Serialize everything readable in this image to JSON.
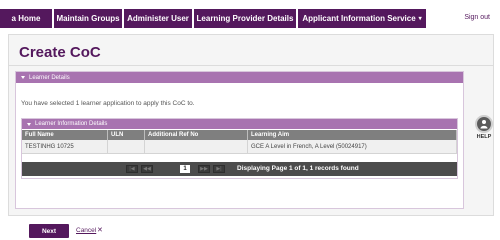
{
  "nav": {
    "items": [
      {
        "label": "a Home"
      },
      {
        "label": "Maintain Groups"
      },
      {
        "label": "Administer User"
      },
      {
        "label": "Learning Provider Details"
      },
      {
        "label": "Applicant Information Service"
      }
    ],
    "dropdown_caret": "▾",
    "signout": "Sign out"
  },
  "page": {
    "title": "Create CoC"
  },
  "learner_details": {
    "header": "Learner Details",
    "message": "You have selected 1 learner application to apply this CoC to."
  },
  "learner_info": {
    "header": "Learner Information Details",
    "columns": [
      "Full Name",
      "ULN",
      "Additional Ref No",
      "Learning Aim"
    ],
    "rows": [
      [
        "TESTINHG 10725",
        "",
        "",
        "GCE A Level in French, A Level (50024917)"
      ]
    ]
  },
  "pager": {
    "first": "|◀",
    "prev": "◀◀",
    "page": "1",
    "next": "▶▶",
    "last": "▶|",
    "status": "Displaying Page 1 of 1, 1 records found"
  },
  "actions": {
    "next": "Next",
    "cancel": "Cancel",
    "cancel_icon": "✕"
  },
  "help": {
    "label": "HELP",
    "icon": "person-help-icon"
  },
  "colors": {
    "brand": "#54185d",
    "panel_header": "#a873b0",
    "table_header": "#7f7f7f",
    "pager": "#4c4c4c"
  }
}
